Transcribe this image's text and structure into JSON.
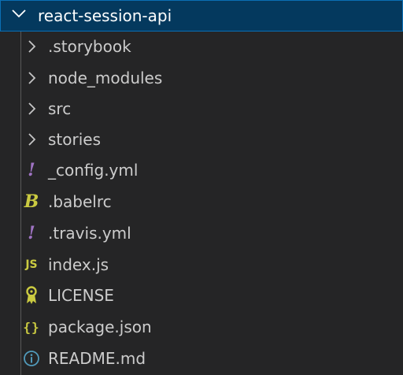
{
  "explorer": {
    "root_folder": "react-session-api",
    "items": [
      {
        "label": ".storybook",
        "kind": "folder",
        "icon": "chevron-right-icon"
      },
      {
        "label": "node_modules",
        "kind": "folder",
        "icon": "chevron-right-icon"
      },
      {
        "label": "src",
        "kind": "folder",
        "icon": "chevron-right-icon"
      },
      {
        "label": "stories",
        "kind": "folder",
        "icon": "chevron-right-icon"
      },
      {
        "label": "_config.yml",
        "kind": "file",
        "icon": "yaml-icon"
      },
      {
        "label": ".babelrc",
        "kind": "file",
        "icon": "babel-icon"
      },
      {
        "label": ".travis.yml",
        "kind": "file",
        "icon": "yaml-icon"
      },
      {
        "label": "index.js",
        "kind": "file",
        "icon": "javascript-icon"
      },
      {
        "label": "LICENSE",
        "kind": "file",
        "icon": "license-icon"
      },
      {
        "label": "package.json",
        "kind": "file",
        "icon": "json-icon"
      },
      {
        "label": "README.md",
        "kind": "file",
        "icon": "info-icon"
      }
    ]
  },
  "icons": {
    "yaml_glyph": "!",
    "babel_glyph": "B",
    "js_glyph": "JS",
    "json_glyph": "{}"
  },
  "colors": {
    "background": "#252526",
    "selected_row": "#04395E",
    "selected_border": "#0A6FB5",
    "text": "#CCCCCC",
    "chevron": "#C5C5C5",
    "yaml": "#A074C4",
    "babel": "#CBCB41",
    "javascript": "#CBCB41",
    "license": "#CBCB41",
    "json": "#CBCB41",
    "info": "#519ABA"
  }
}
